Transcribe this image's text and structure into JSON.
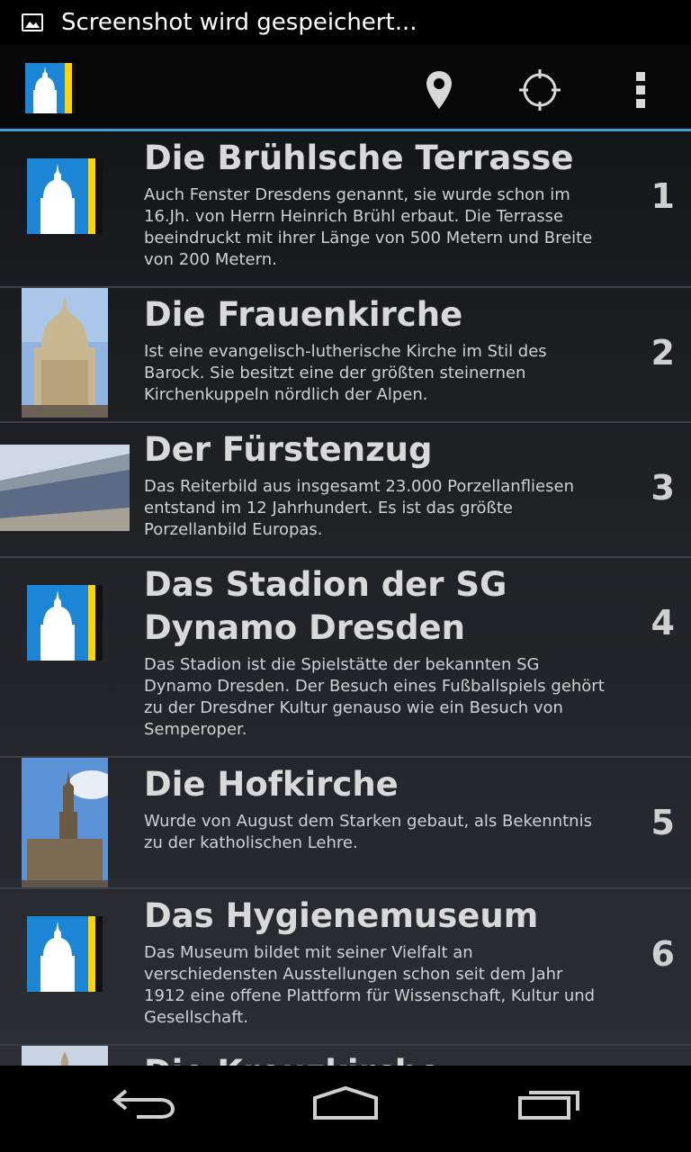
{
  "status_bar": {
    "icon": "image-icon",
    "text": "Screenshot wird gespeichert..."
  },
  "action_bar": {
    "app_icon": "dresden-frauenkirche-logo",
    "actions": [
      "map-pin-icon",
      "crosshair-location-icon",
      "overflow-menu-icon"
    ]
  },
  "colors": {
    "accent": "#3aa3d8",
    "logo_blue": "#1b86d6",
    "logo_yellow": "#ffd400",
    "row_bg_top": "#141518",
    "row_bg_bottom": "#2a2d33"
  },
  "list": {
    "items": [
      {
        "title": "Die Brühlsche Terrasse",
        "description": "Auch Fenster Dresdens genannt, sie wurde schon im 16.Jh. von Herrn Heinrich Brühl erbaut. Die Terrasse beeindruckt mit ihrer Länge von 500 Metern und Breite von 200 Metern.",
        "number": "1",
        "thumbnail": "app-logo"
      },
      {
        "title": "Die Frauenkirche",
        "description": "Ist eine evangelisch-lutherische Kirche im Stil des Barock. Sie besitzt eine der größten steinernen Kirchenkuppeln nördlich der Alpen.",
        "number": "2",
        "thumbnail": "frauenkirche-photo"
      },
      {
        "title": "Der Fürstenzug",
        "description": "Das Reiterbild aus insgesamt 23.000 Porzellanfliesen entstand im 12 Jahrhundert. Es ist das größte Porzellanbild Europas.",
        "number": "3",
        "thumbnail": "fuerstenzug-photo"
      },
      {
        "title": "Das Stadion der SG Dynamo Dresden",
        "description": "Das Stadion ist die Spielstätte der bekannten SG Dynamo Dresden. Der Besuch eines Fußballspiels gehört zu der Dresdner Kultur genauso wie ein Besuch von Semperoper.",
        "number": "4",
        "thumbnail": "app-logo"
      },
      {
        "title": "Die Hofkirche",
        "description": "Wurde von August dem Starken gebaut, als Bekenntnis zu der katholischen Lehre.",
        "number": "5",
        "thumbnail": "hofkirche-photo"
      },
      {
        "title": "Das Hygienemuseum",
        "description": "Das Museum bildet mit seiner Vielfalt an verschiedensten Ausstellungen schon seit dem Jahr 1912 eine offene Plattform für Wissenschaft, Kultur und Gesellschaft.",
        "number": "6",
        "thumbnail": "app-logo"
      },
      {
        "title": "Die Kreuzkirche",
        "description": "",
        "number": "",
        "thumbnail": "kreuzkirche-photo"
      }
    ]
  },
  "nav_bar": {
    "buttons": [
      "back-icon",
      "home-icon",
      "recent-apps-icon"
    ]
  }
}
